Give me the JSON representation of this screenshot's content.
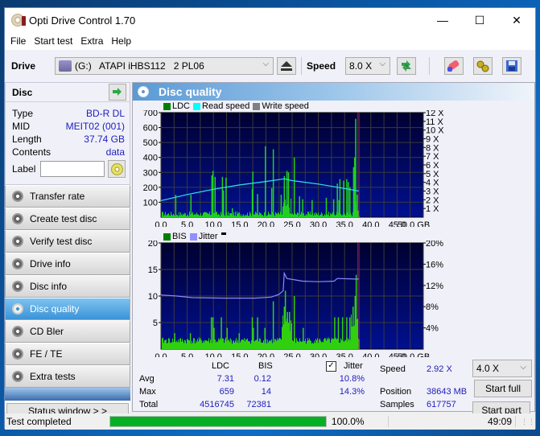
{
  "window": {
    "title": "Opti Drive Control 1.70",
    "controls": {
      "minimize": "—",
      "maximize": "☐",
      "close": "✕"
    }
  },
  "menu": [
    "File",
    "Start test",
    "Extra",
    "Help"
  ],
  "toolbar": {
    "drive_label": "Drive",
    "drive_value": "(G:)   ATAPI iHBS112   2 PL06",
    "speed_label": "Speed",
    "speed_value": "8.0 X",
    "icons": [
      "eject-icon",
      "refresh-icon",
      "erase-icon",
      "settings-icon",
      "save-icon"
    ]
  },
  "disc": {
    "heading": "Disc",
    "rows": [
      {
        "label": "Type",
        "value": "BD-R DL"
      },
      {
        "label": "MID",
        "value": "MEIT02 (001)"
      },
      {
        "label": "Length",
        "value": "37.74 GB"
      },
      {
        "label": "Contents",
        "value": "data"
      }
    ],
    "label_field": {
      "label": "Label",
      "value": ""
    }
  },
  "nav": [
    {
      "label": "Transfer rate",
      "active": false
    },
    {
      "label": "Create test disc",
      "active": false
    },
    {
      "label": "Verify test disc",
      "active": false
    },
    {
      "label": "Drive info",
      "active": false
    },
    {
      "label": "Disc info",
      "active": false
    },
    {
      "label": "Disc quality",
      "active": true
    },
    {
      "label": "CD Bler",
      "active": false
    },
    {
      "label": "FE / TE",
      "active": false
    },
    {
      "label": "Extra tests",
      "active": false
    }
  ],
  "status_window_label": "Status window > >",
  "main": {
    "heading": "Disc quality",
    "top_legend": [
      {
        "label": "LDC",
        "color": "#008000"
      },
      {
        "label": "Read speed",
        "color": "#00ffff"
      },
      {
        "label": "Write speed",
        "color": "#808080"
      }
    ],
    "bottom_legend": [
      {
        "label": "BIS",
        "color": "#008000"
      },
      {
        "label": "Jitter",
        "color": "#9090ff"
      }
    ]
  },
  "chart_data": [
    {
      "type": "bar",
      "title": "LDC / Read speed",
      "xlabel": "GB",
      "xlim": [
        0,
        50
      ],
      "x_ticks": [
        "0.0",
        "5.0",
        "10.0",
        "15.0",
        "20.0",
        "25.0",
        "30.0",
        "35.0",
        "40.0",
        "45.0",
        "50.0 GB"
      ],
      "y_left_ticks": [
        "100",
        "200",
        "300",
        "400",
        "500",
        "600",
        "700"
      ],
      "ylim_left": [
        0,
        700
      ],
      "y_right_ticks": [
        "1 X",
        "2 X",
        "3 X",
        "4 X",
        "5 X",
        "6 X",
        "7 X",
        "8 X",
        "9 X",
        "10 X",
        "11 X",
        "12 X"
      ],
      "ylim_right": [
        0,
        12
      ],
      "disc_end_gb": 37.74,
      "series": [
        {
          "name": "LDC",
          "kind": "bar",
          "baseline": 20,
          "spikes": [
            [
              2.7,
              150
            ],
            [
              5.6,
              150
            ],
            [
              9.6,
              280
            ],
            [
              9.8,
              310
            ],
            [
              10.2,
              270
            ],
            [
              11.6,
              270
            ],
            [
              11.8,
              180
            ],
            [
              12.3,
              265
            ],
            [
              13.5,
              60
            ],
            [
              17.3,
              190
            ],
            [
              17.4,
              305
            ],
            [
              18.3,
              155
            ],
            [
              19.8,
              475
            ],
            [
              21.0,
              195
            ],
            [
              21.3,
              455
            ],
            [
              22.8,
              150
            ],
            [
              23.4,
              275
            ],
            [
              23.9,
              310
            ],
            [
              24.2,
              300
            ],
            [
              25.3,
              400
            ],
            [
              26.3,
              140
            ],
            [
              26.9,
              120
            ],
            [
              28.7,
              115
            ],
            [
              31.4,
              130
            ],
            [
              32.8,
              120
            ],
            [
              33.5,
              225
            ],
            [
              33.8,
              115
            ],
            [
              34.0,
              255
            ],
            [
              34.7,
              245
            ],
            [
              35.3,
              255
            ],
            [
              35.6,
              235
            ],
            [
              35.9,
              200
            ],
            [
              36.6,
              335
            ],
            [
              36.8,
              400
            ],
            [
              37.0,
              659
            ],
            [
              37.3,
              150
            ]
          ]
        },
        {
          "name": "Read speed",
          "kind": "line",
          "unit": "X",
          "points": [
            [
              0,
              1.9
            ],
            [
              5,
              2.6
            ],
            [
              10,
              3.2
            ],
            [
              15,
              3.7
            ],
            [
              20,
              4.1
            ],
            [
              23.5,
              4.4
            ],
            [
              25,
              4.2
            ],
            [
              30,
              3.8
            ],
            [
              35,
              3.3
            ],
            [
              37.7,
              3.0
            ]
          ]
        }
      ]
    },
    {
      "type": "bar",
      "title": "BIS / Jitter",
      "xlabel": "GB",
      "xlim": [
        0,
        50
      ],
      "x_ticks": [
        "0.0",
        "5.0",
        "10.0",
        "15.0",
        "20.0",
        "25.0",
        "30.0",
        "35.0",
        "40.0",
        "45.0",
        "50.0 GB"
      ],
      "y_left_ticks": [
        "5",
        "10",
        "15",
        "20"
      ],
      "ylim_left": [
        0,
        20
      ],
      "y_right_ticks": [
        "4%",
        "8%",
        "12%",
        "16%",
        "20%"
      ],
      "ylim_right": [
        0,
        20
      ],
      "disc_end_gb": 37.74,
      "series": [
        {
          "name": "BIS",
          "kind": "bar",
          "baseline": 1,
          "spikes": [
            [
              2.5,
              3
            ],
            [
              5.5,
              3
            ],
            [
              9.5,
              6
            ],
            [
              9.8,
              6
            ],
            [
              10.0,
              4
            ],
            [
              11.4,
              6
            ],
            [
              12.5,
              4
            ],
            [
              14.8,
              3
            ],
            [
              17.3,
              6
            ],
            [
              17.5,
              4
            ],
            [
              18.3,
              6
            ],
            [
              19.7,
              4
            ],
            [
              21.3,
              9
            ],
            [
              23.4,
              8
            ],
            [
              23.6,
              11
            ],
            [
              24.0,
              7
            ],
            [
              24.4,
              7
            ],
            [
              25.3,
              10
            ],
            [
              27.0,
              4
            ],
            [
              33.0,
              6
            ],
            [
              33.7,
              6
            ],
            [
              34.5,
              6
            ],
            [
              35.3,
              6
            ],
            [
              35.9,
              6
            ],
            [
              36.5,
              8
            ],
            [
              36.9,
              10
            ],
            [
              37.1,
              14
            ]
          ]
        },
        {
          "name": "Jitter",
          "kind": "line",
          "unit": "%",
          "points": [
            [
              0,
              10.2
            ],
            [
              3,
              10.0
            ],
            [
              6,
              9.7
            ],
            [
              12,
              9.6
            ],
            [
              18,
              9.6
            ],
            [
              21,
              9.8
            ],
            [
              22.5,
              10.3
            ],
            [
              23.3,
              11.0
            ],
            [
              23.5,
              14.3
            ],
            [
              24.0,
              13.3
            ],
            [
              27,
              12.8
            ],
            [
              30,
              12.7
            ],
            [
              33,
              12.8
            ],
            [
              33.6,
              13.3
            ],
            [
              37,
              13.2
            ],
            [
              37.7,
              13.2
            ]
          ]
        }
      ]
    }
  ],
  "stats": {
    "headers": {
      "ldc": "LDC",
      "bis": "BIS",
      "jitter": "Jitter"
    },
    "jitter_checked": true,
    "rows": [
      {
        "label": "Avg",
        "ldc": "7.31",
        "bis": "0.12",
        "jitter": "10.8%"
      },
      {
        "label": "Max",
        "ldc": "659",
        "bis": "14",
        "jitter": "14.3%"
      },
      {
        "label": "Total",
        "ldc": "4516745",
        "bis": "72381",
        "jitter": ""
      }
    ],
    "speed_label": "Speed",
    "speed_value": "2.92 X",
    "position_label": "Position",
    "position_value": "38643 MB",
    "samples_label": "Samples",
    "samples_value": "617757",
    "test_speed_select": "4.0 X",
    "start_full_label": "Start full",
    "start_part_label": "Start part"
  },
  "statusbar": {
    "message": "Test completed",
    "progress_percent": 100,
    "progress_text": "100.0%",
    "elapsed": "49:09"
  }
}
